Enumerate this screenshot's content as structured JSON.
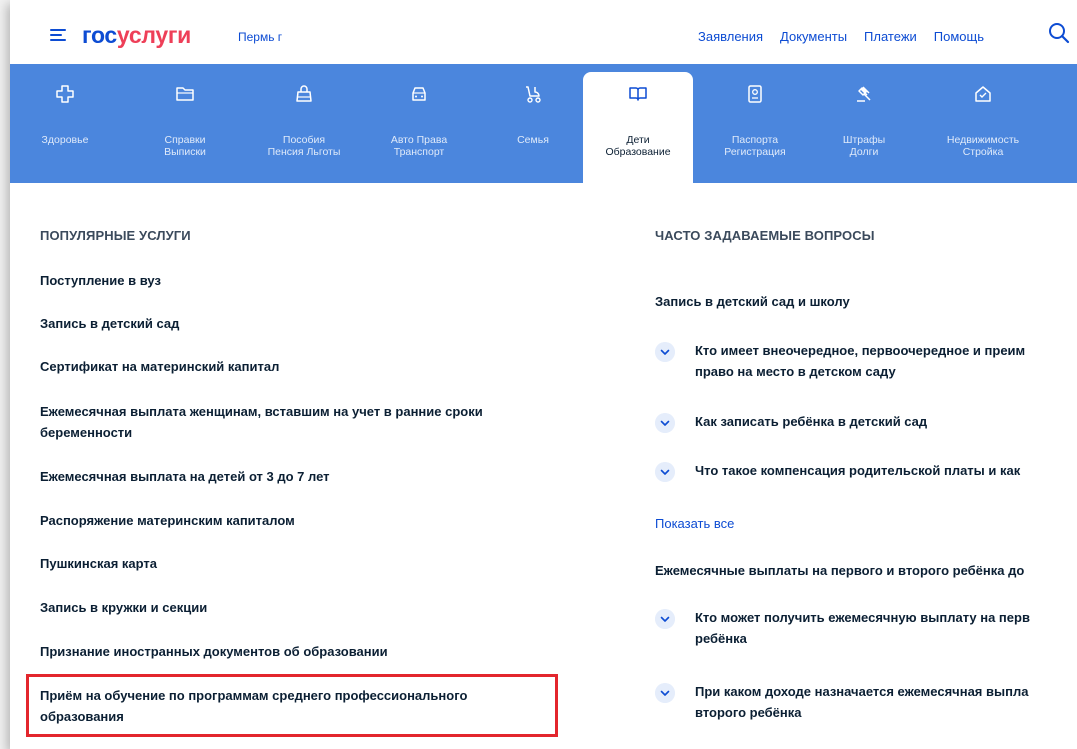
{
  "header": {
    "logo_gos": "гос",
    "logo_uslugi": "услуги",
    "region": "Пермь г",
    "nav": [
      "Заявления",
      "Документы",
      "Платежи",
      "Помощь"
    ]
  },
  "categories": [
    {
      "line1": "Здоровье",
      "line2": "",
      "icon": "health-cross-icon",
      "active": false
    },
    {
      "line1": "Справки",
      "line2": "Выписки",
      "icon": "folder-icon",
      "active": false
    },
    {
      "line1": "Пособия",
      "line2": "Пенсия Льготы",
      "icon": "wallet-icon",
      "active": false
    },
    {
      "line1": "Авто Права",
      "line2": "Транспорт",
      "icon": "car-icon",
      "active": false
    },
    {
      "line1": "Семья",
      "line2": "",
      "icon": "stroller-icon",
      "active": false
    },
    {
      "line1": "Дети",
      "line2": "Образование",
      "icon": "book-icon",
      "active": true
    },
    {
      "line1": "Паспорта",
      "line2": "Регистрация",
      "icon": "passport-icon",
      "active": false
    },
    {
      "line1": "Штрафы",
      "line2": "Долги",
      "icon": "gavel-icon",
      "active": false
    },
    {
      "line1": "Недвижимость",
      "line2": "Стройка",
      "icon": "house-icon",
      "active": false
    }
  ],
  "popular": {
    "title": "ПОПУЛЯРНЫЕ УСЛУГИ",
    "items": [
      "Поступление в вуз",
      "Запись в детский сад",
      "Сертификат на материнский капитал",
      "Ежемесячная выплата женщинам, вставшим на учет в ранние сроки беременности",
      "Ежемесячная выплата на детей от 3 до 7 лет",
      "Распоряжение материнским капиталом",
      "Пушкинская карта",
      "Запись в кружки и секции",
      "Признание иностранных документов об образовании",
      "Приём на обучение по программам среднего профессионального образования"
    ]
  },
  "faq": {
    "title": "ЧАСТО ЗАДАВАЕМЫЕ ВОПРОСЫ",
    "group1_title": "Запись в детский сад и школу",
    "group1_items": [
      "Кто имеет внеочередное, первоочередное и преим\nправо на место в детском саду",
      "Как записать ребёнка в детский сад",
      "Что такое компенсация родительской платы и как"
    ],
    "show_all": "Показать все",
    "group2_title": "Ежемесячные выплаты на первого и второго ребёнка до",
    "group2_items": [
      "Кто может получить ежемесячную выплату на перв\nребёнка",
      "При каком доходе назначается ежемесячная выпла\nвторого ребёнка"
    ]
  },
  "colors": {
    "brand_blue": "#0d4cd3",
    "brand_red": "#ee3f58",
    "band": "#4b86dd",
    "highlight": "#e3262d"
  }
}
